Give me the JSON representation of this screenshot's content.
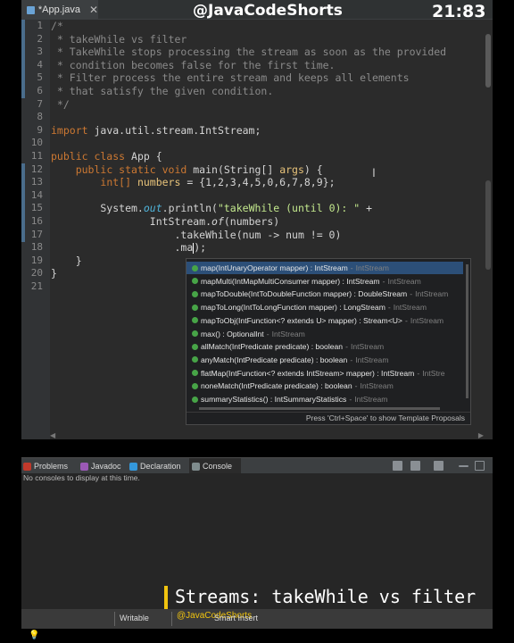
{
  "editor": {
    "tab_title": "*App.java",
    "tab_close": "✕"
  },
  "overlay": {
    "handle": "@JavaCodeShorts",
    "timer": "21:83"
  },
  "code": {
    "line_numbers": [
      "1",
      "2",
      "3",
      "4",
      "5",
      "6",
      "7",
      "8",
      "9",
      "10",
      "11",
      "12",
      "13",
      "14",
      "15",
      "16",
      "17",
      "18",
      "19",
      "20",
      "21"
    ],
    "l1": "/*",
    "l2": " * takeWhile vs filter",
    "l3": " * TakeWhile stops processing the stream as soon as the provided",
    "l4": " * condition becomes false for the first time.",
    "l5": " * Filter process the entire stream and keeps all elements",
    "l6": " * that satisfy the given condition.",
    "l7": " */",
    "l9_kw": "import",
    "l9_rest": " java.util.stream.IntStream;",
    "l11_kw": "public class",
    "l11_rest": " App {",
    "l12_indent": "    ",
    "l12_kw": "public static void",
    "l12_rest": " main(String[] ",
    "l12_var": "args",
    "l12_end": ") {",
    "l13_indent": "        ",
    "l13_type": "int[] ",
    "l13_var": "numbers",
    "l13_rest": " = {1,2,3,4,5,0,6,7,8,9};",
    "l15_indent": "        System.",
    "l15_field": "out",
    "l15_call": ".println(",
    "l15_str": "\"takeWhile (until 0): \"",
    "l15_end": " +",
    "l16_indent": "                IntStream.",
    "l16_static": "of",
    "l16_rest": "(numbers)",
    "l17": "                    .takeWhile(num -> num != 0)",
    "l18": "                    .ma",
    "l18_end": ");",
    "l19": "    }",
    "l20": "}"
  },
  "autocomplete": {
    "items": [
      {
        "sig": "map(IntUnaryOperator mapper) : IntStream",
        "owner": "IntStream",
        "selected": true
      },
      {
        "sig": "mapMulti(IntMapMultiConsumer mapper) : IntStream",
        "owner": "IntStream"
      },
      {
        "sig": "mapToDouble(IntToDoubleFunction mapper) : DoubleStream",
        "owner": "IntStream"
      },
      {
        "sig": "mapToLong(IntToLongFunction mapper) : LongStream",
        "owner": "IntStream"
      },
      {
        "sig": "mapToObj(IntFunction<? extends U> mapper) : Stream<U>",
        "owner": "IntStream"
      },
      {
        "sig": "max() : OptionalInt",
        "owner": "IntStream"
      },
      {
        "sig": "allMatch(IntPredicate predicate) : boolean",
        "owner": "IntStream"
      },
      {
        "sig": "anyMatch(IntPredicate predicate) : boolean",
        "owner": "IntStream"
      },
      {
        "sig": "flatMap(IntFunction<? extends IntStream> mapper) : IntStream",
        "owner": "IntStre"
      },
      {
        "sig": "noneMatch(IntPredicate predicate) : boolean",
        "owner": "IntStream"
      },
      {
        "sig": "summaryStatistics() : IntSummaryStatistics",
        "owner": "IntStream"
      }
    ],
    "separator": " - ",
    "footer": "Press 'Ctrl+Space' to show Template Proposals"
  },
  "panel": {
    "tabs": [
      {
        "label": "Problems",
        "icon": "problems-icon",
        "color": "#c0392b"
      },
      {
        "label": "Javadoc",
        "icon": "javadoc-icon",
        "color": "#9b59b6"
      },
      {
        "label": "Declaration",
        "icon": "declaration-icon",
        "color": "#3498db"
      },
      {
        "label": "Console",
        "icon": "console-icon",
        "color": "#7f8c8d"
      }
    ],
    "console_message": "No consoles to display at this time."
  },
  "caption": {
    "text": "Streams: takeWhile vs filter",
    "accent": "#f1c40f"
  },
  "status": {
    "writable": "Writable",
    "watermark": "@JavaCodeShorts",
    "insert_mode": "Smart Insert"
  }
}
